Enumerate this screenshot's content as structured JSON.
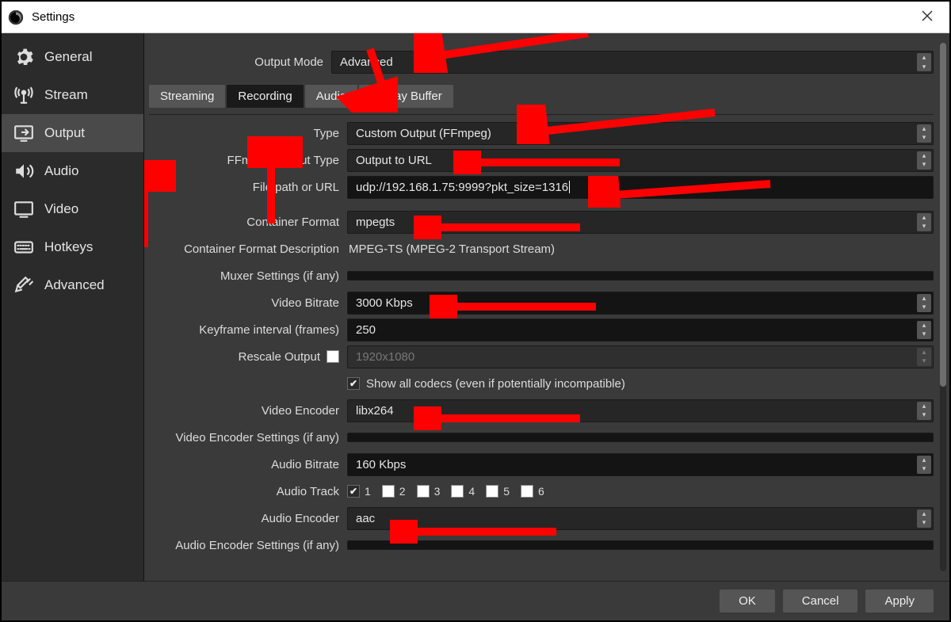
{
  "window": {
    "title": "Settings"
  },
  "sidebar": {
    "items": [
      {
        "label": "General"
      },
      {
        "label": "Stream"
      },
      {
        "label": "Output"
      },
      {
        "label": "Audio"
      },
      {
        "label": "Video"
      },
      {
        "label": "Hotkeys"
      },
      {
        "label": "Advanced"
      }
    ]
  },
  "outputMode": {
    "label": "Output Mode",
    "value": "Advanced"
  },
  "tabs": [
    {
      "label": "Streaming"
    },
    {
      "label": "Recording"
    },
    {
      "label": "Audio"
    },
    {
      "label": "Replay Buffer"
    }
  ],
  "fields": {
    "type": {
      "label": "Type",
      "value": "Custom Output (FFmpeg)"
    },
    "ffmpegOutputType": {
      "label": "FFmpeg Output Type",
      "value": "Output to URL"
    },
    "filePath": {
      "label": "File path or URL",
      "value": "udp://192.168.1.75:9999?pkt_size=1316"
    },
    "containerFormat": {
      "label": "Container Format",
      "value": "mpegts"
    },
    "containerDesc": {
      "label": "Container Format Description",
      "value": "MPEG-TS (MPEG-2 Transport Stream)"
    },
    "muxerSettings": {
      "label": "Muxer Settings (if any)",
      "value": ""
    },
    "videoBitrate": {
      "label": "Video Bitrate",
      "value": "3000 Kbps"
    },
    "keyframe": {
      "label": "Keyframe interval (frames)",
      "value": "250"
    },
    "rescale": {
      "label": "Rescale Output",
      "checked": false,
      "placeholder": "1920x1080"
    },
    "showAllCodecs": {
      "label": "Show all codecs (even if potentially incompatible)",
      "checked": true
    },
    "videoEncoder": {
      "label": "Video Encoder",
      "value": "libx264"
    },
    "videoEncSettings": {
      "label": "Video Encoder Settings (if any)",
      "value": ""
    },
    "audioBitrate": {
      "label": "Audio Bitrate",
      "value": "160 Kbps"
    },
    "audioTrack": {
      "label": "Audio Track",
      "tracks": [
        "1",
        "2",
        "3",
        "4",
        "5",
        "6"
      ],
      "checked": [
        true,
        false,
        false,
        false,
        false,
        false
      ]
    },
    "audioEncoder": {
      "label": "Audio Encoder",
      "value": "aac"
    },
    "audioEncSettings": {
      "label": "Audio Encoder Settings (if any)",
      "value": ""
    }
  },
  "footer": {
    "ok": "OK",
    "cancel": "Cancel",
    "apply": "Apply"
  }
}
